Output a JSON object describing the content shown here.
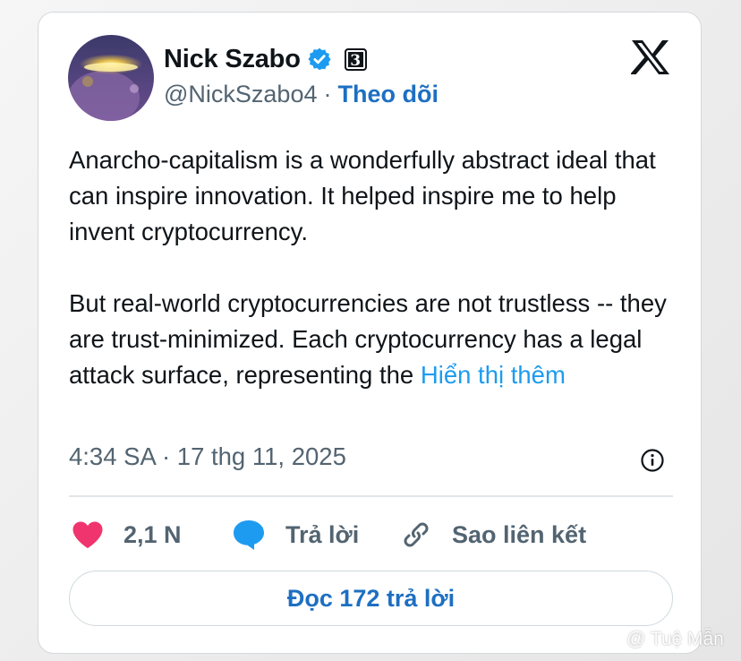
{
  "author": {
    "display_name": "Nick Szabo",
    "handle": "@NickSzabo4",
    "separator": "·",
    "follow_label": "Theo dõi",
    "affiliate_badge": "3"
  },
  "tweet": {
    "paragraph1": "Anarcho-capitalism is a wonderfully abstract ideal that can inspire innovation. It helped inspire me to help invent cryptocurrency.",
    "paragraph2": "But real-world cryptocurrencies are not trustless -- they are trust-minimized. Each cryptocurrency has a legal attack surface, representing the ",
    "show_more": "Hiển thị thêm",
    "timestamp": "4:34 SA · 17 thg 11, 2025"
  },
  "actions": {
    "likes": "2,1 N",
    "reply": "Trả lời",
    "copy_link": "Sao liên kết",
    "read_replies": "Đọc 172 trả lời"
  },
  "icons": {
    "verified": "verified-badge-icon",
    "platform": "x-logo-icon",
    "info": "info-icon",
    "like": "heart-icon",
    "reply": "speech-bubble-icon",
    "link": "link-icon"
  },
  "colors": {
    "text": "#0f1419",
    "secondary": "#536471",
    "link": "#1d9bf0",
    "follow": "#1d6fc2",
    "heart": "#f0346e",
    "reply_bubble": "#1d9bf0",
    "verified": "#1d9bf0"
  },
  "watermark": "@ Tuệ Mẫn"
}
